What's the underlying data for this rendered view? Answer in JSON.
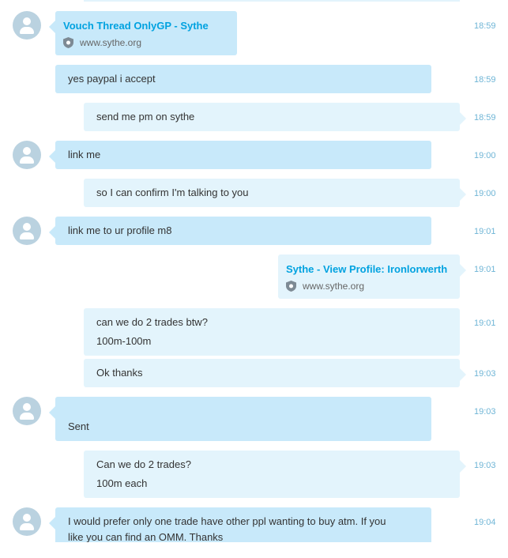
{
  "messages": [
    {
      "type": "link",
      "title": "Vouch Thread OnlyGP - Sythe",
      "site": "www.sythe.org",
      "time": "18:59"
    },
    {
      "text": "yes paypal i accept",
      "time": "18:59"
    },
    {
      "text": "send me pm on sythe",
      "time": "18:59"
    },
    {
      "text": "link me",
      "time": "19:00"
    },
    {
      "text": "so I can confirm I'm talking to you",
      "time": "19:00"
    },
    {
      "text": "link me to ur profile m8",
      "time": "19:01"
    },
    {
      "type": "link",
      "title": "Sythe - View Profile: Ironlorwerth",
      "site": "www.sythe.org",
      "time": "19:01"
    },
    {
      "lines": [
        "can we do 2 trades btw?",
        "100m-100m"
      ],
      "time": "19:01"
    },
    {
      "text": "Ok thanks",
      "time": "19:03"
    },
    {
      "text": "Sent",
      "time": "19:03"
    },
    {
      "lines": [
        "Can we do 2 trades?",
        "100m each"
      ],
      "time": "19:03"
    },
    {
      "lines": [
        "I would prefer only one trade have other ppl wanting to buy atm. If you",
        "like you can find an OMM. Thanks"
      ],
      "time": "19:04"
    }
  ],
  "icons": {
    "avatar": "user-avatar-icon",
    "shield": "shield-icon"
  },
  "colors": {
    "incoming_bubble": "#c8e9fa",
    "outgoing_bubble": "#e3f4fc",
    "timestamp": "#6fb5d6",
    "link": "#00a2e0"
  }
}
